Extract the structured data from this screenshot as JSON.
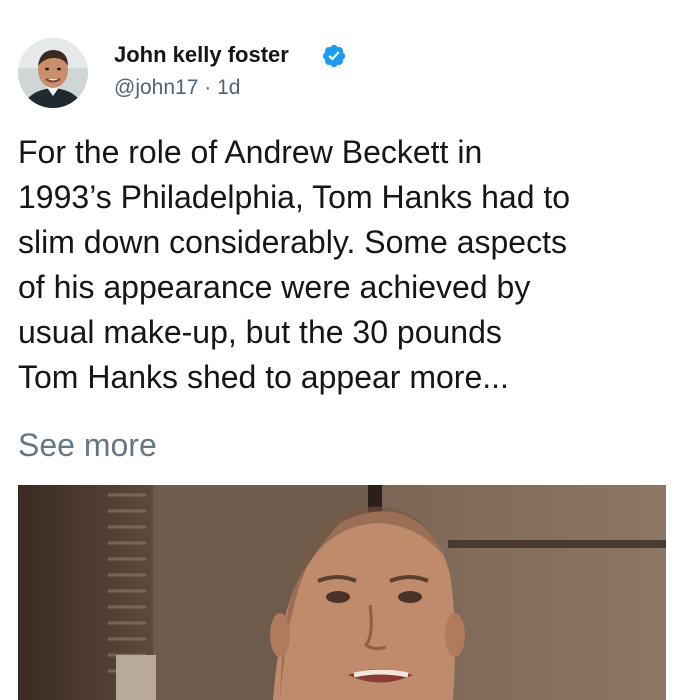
{
  "tweet": {
    "author_name": "John kelly foster",
    "verified_icon": "verified-badge-icon",
    "handle": "@john17",
    "separator": "·",
    "time": "1d",
    "text_lines": [
      "For the role of Andrew Beckett in",
      "1993’s Philadelphia, Tom Hanks had to",
      "slim down considerably. Some aspects",
      "of his appearance were achieved by",
      "usual make-up, but the 30 pounds",
      "Tom Hanks shed to appear more..."
    ],
    "see_more": "See more"
  },
  "colors": {
    "verified": "#1d9bf0",
    "secondary_text": "#657786",
    "primary_text": "#14171a"
  }
}
